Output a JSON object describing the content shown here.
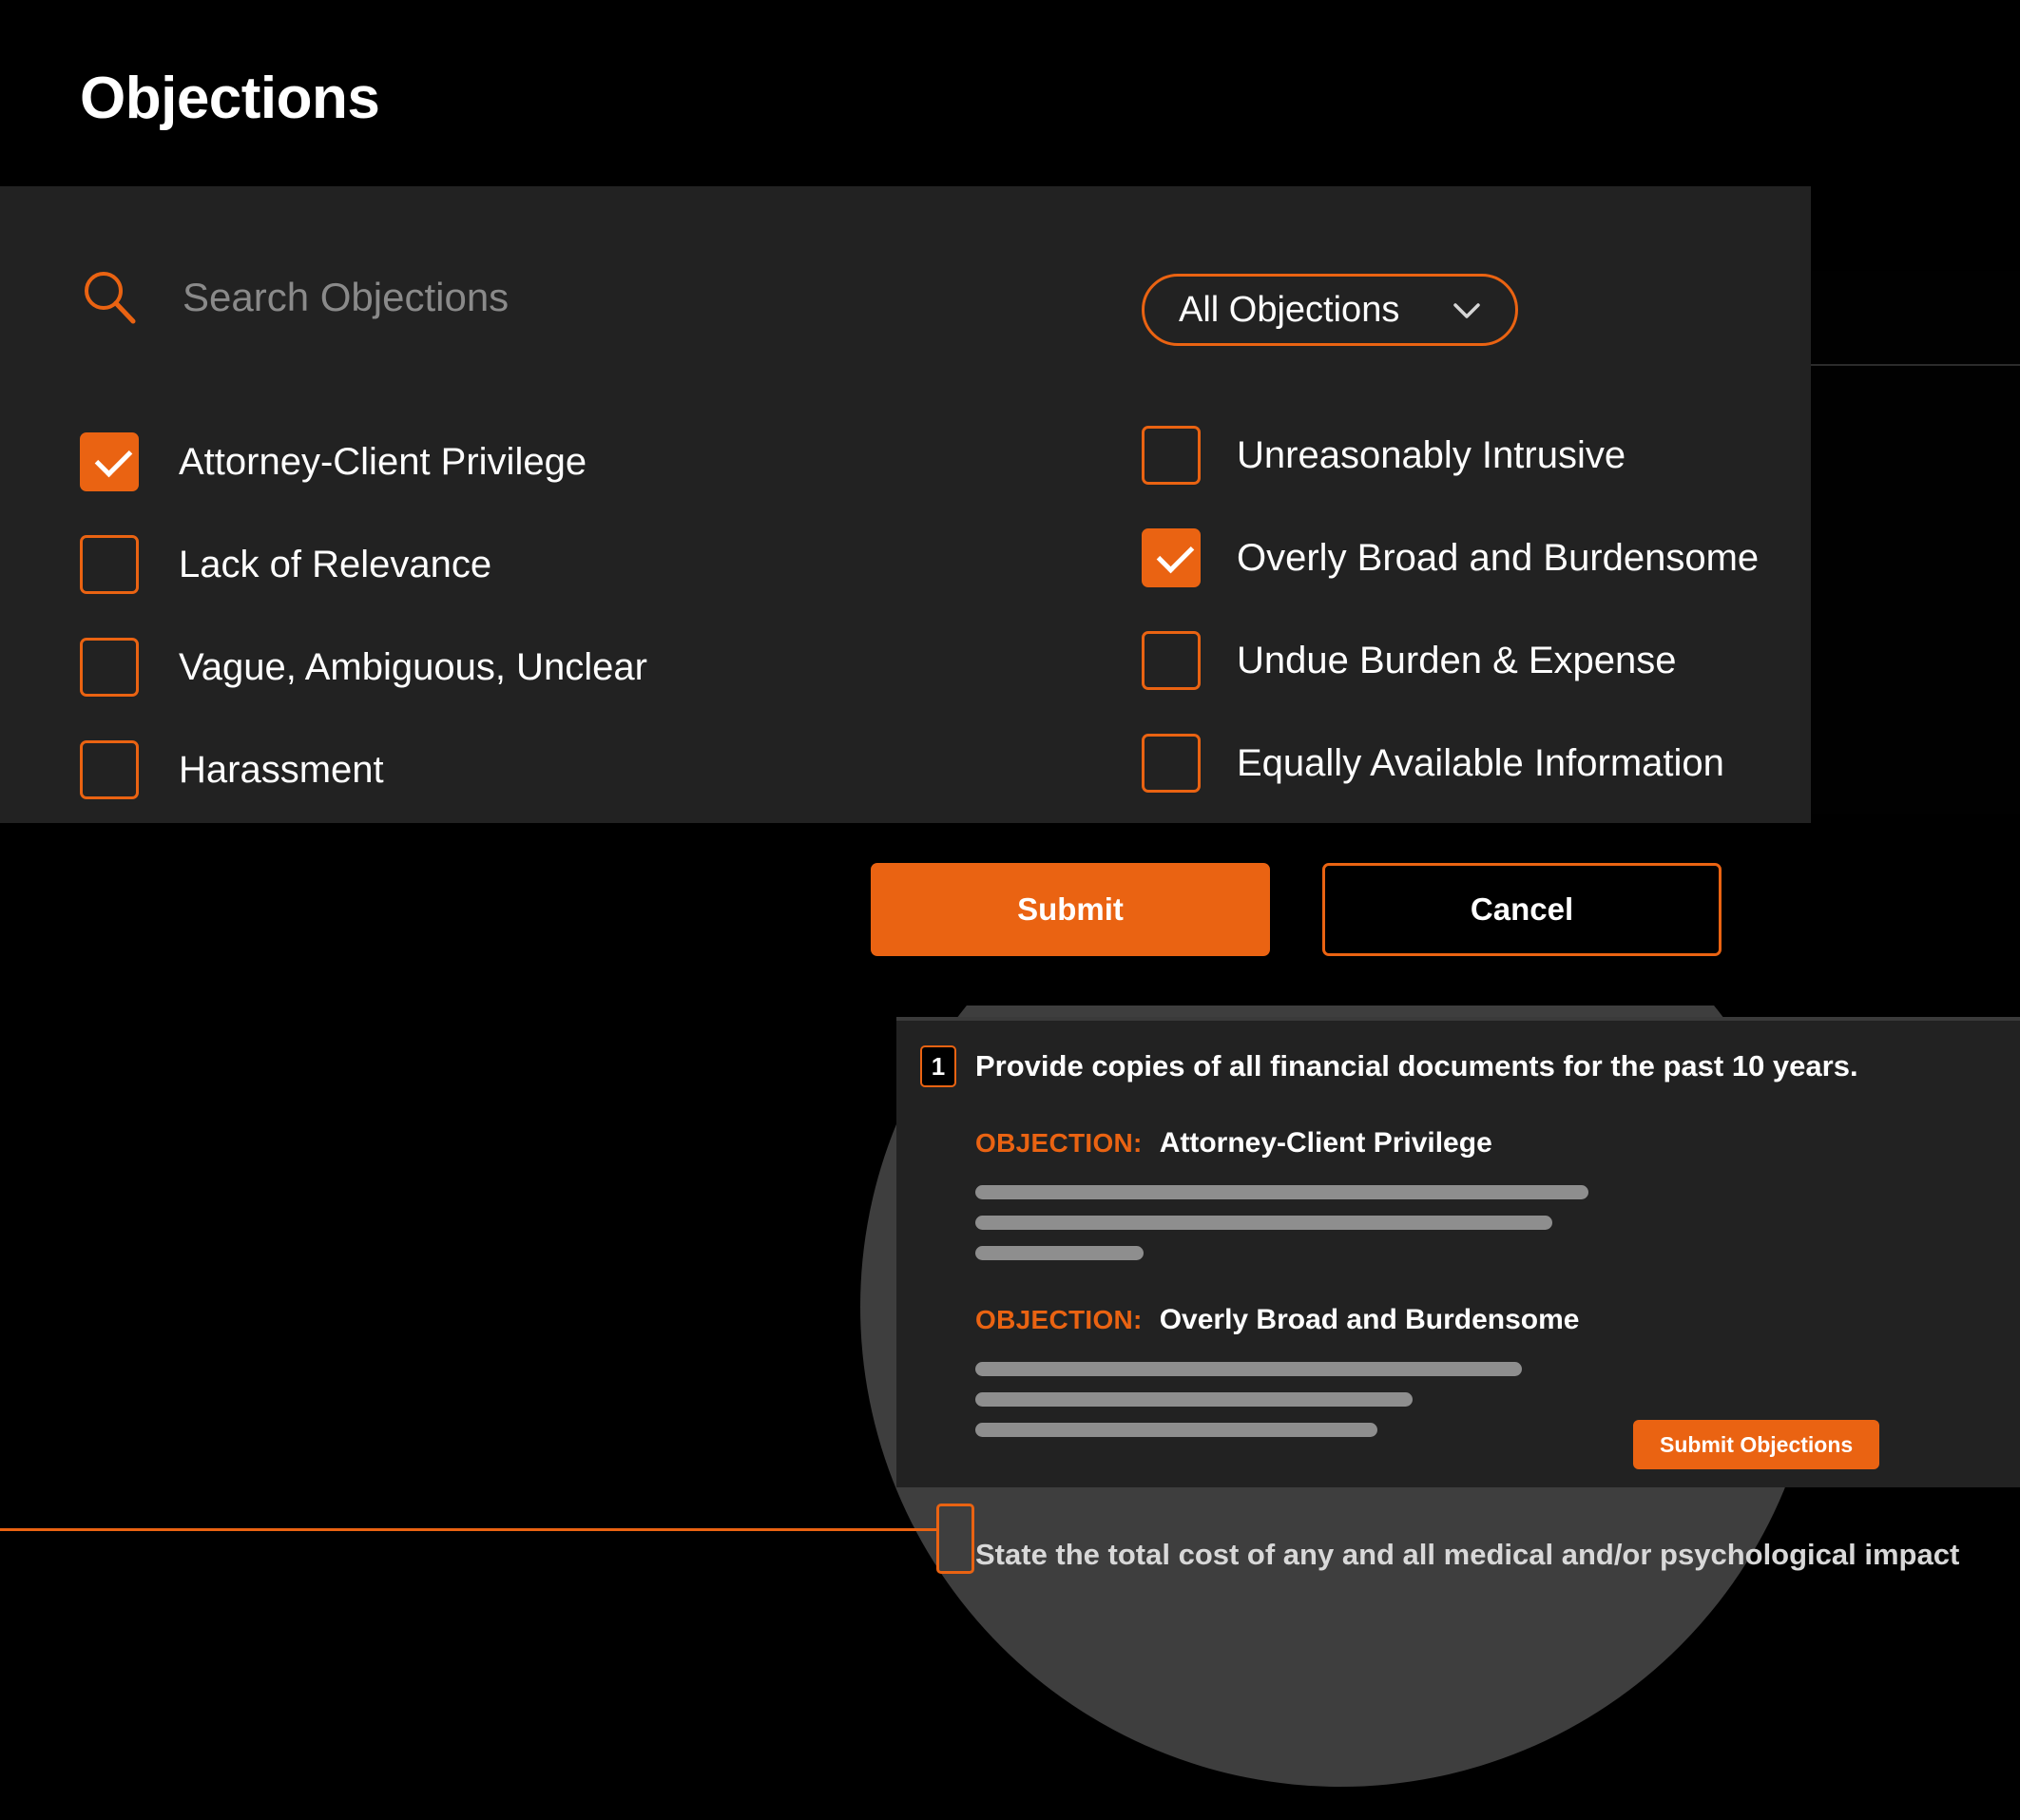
{
  "header": {
    "title": "Objections"
  },
  "search": {
    "icon": "search-icon",
    "placeholder": "Search Objections",
    "value": ""
  },
  "filter": {
    "selected": "All Objections",
    "icon": "chevron-down-icon"
  },
  "objection_options": {
    "left_column": [
      {
        "label": "Attorney-Client Privilege",
        "checked": true
      },
      {
        "label": "Lack of Relevance",
        "checked": false
      },
      {
        "label": "Vague, Ambiguous, Unclear",
        "checked": false
      },
      {
        "label": "Harassment",
        "checked": false
      }
    ],
    "right_column": [
      {
        "label": "Unreasonably Intrusive",
        "checked": false
      },
      {
        "label": "Overly Broad and Burdensome",
        "checked": true
      },
      {
        "label": "Undue Burden & Expense",
        "checked": false
      },
      {
        "label": "Equally Available Information",
        "checked": false
      }
    ]
  },
  "actions": {
    "submit_label": "Submit",
    "cancel_label": "Cancel"
  },
  "result_card": {
    "question_number": "1",
    "question_text": "Provide copies of all financial documents for the past 10 years.",
    "objections": [
      {
        "tag": "OBJECTION:",
        "name": "Attorney-Client Privilege"
      },
      {
        "tag": "OBJECTION:",
        "name": "Overly Broad and Burdensome"
      }
    ],
    "submit_objections_label": "Submit Objections"
  },
  "bottom_row": {
    "text": "State the total cost of any and all medical and/or psychological impact"
  },
  "colors": {
    "accent": "#EA6312",
    "panel_dark": "#222222",
    "page_background": "#000000",
    "circle_overlay": "#3E3E3E",
    "skeleton": "#8E8E8E",
    "muted_text": "#8A8A8A"
  }
}
